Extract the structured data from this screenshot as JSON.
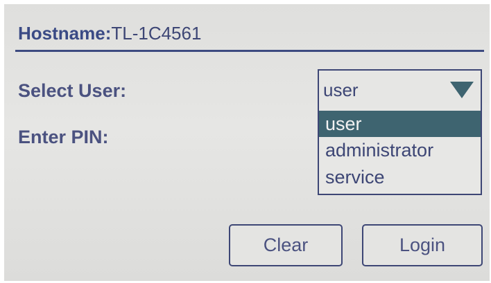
{
  "header": {
    "hostname_label": "Hostname:",
    "hostname_value": "TL-1C4561"
  },
  "form": {
    "select_user_label": "Select User:",
    "pin_label": "Enter PIN:",
    "user_select": {
      "value": "user",
      "icon": "dropdown-triangle-icon",
      "options": [
        "user",
        "administrator",
        "service"
      ],
      "highlighted_option": "user"
    }
  },
  "buttons": {
    "clear_label": "Clear",
    "login_label": "Login"
  },
  "colors": {
    "text": "#3d4675",
    "highlight": "#3e6470",
    "screen_bg": "#e3e3e1"
  }
}
